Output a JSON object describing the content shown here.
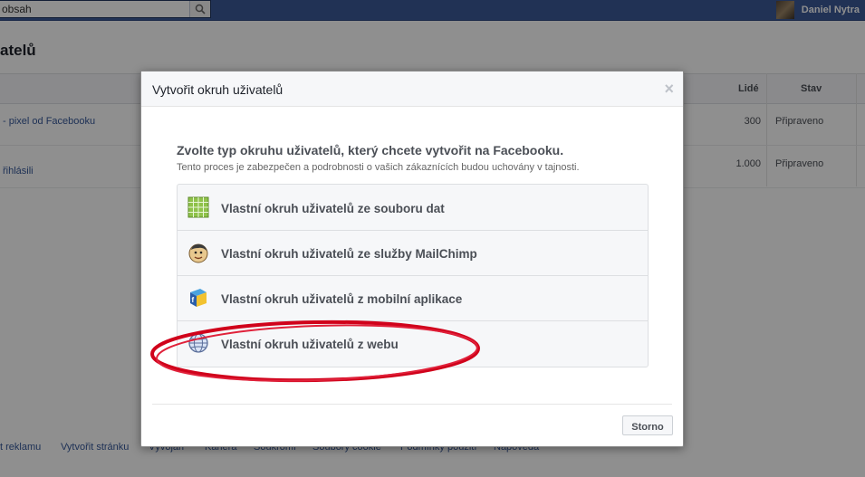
{
  "header": {
    "search_value": "obsah",
    "user_name": "Daniel Nytra"
  },
  "page": {
    "title": "atelů",
    "columns": {
      "lide": "Lidé",
      "stav": "Stav"
    },
    "rows": [
      {
        "name": "- pixel od Facebooku",
        "count": "300",
        "status": "Připraveno"
      },
      {
        "name": "řihlásili",
        "count": "1.000",
        "status": "Připraveno"
      }
    ]
  },
  "footer": {
    "links": [
      "t reklamu",
      "Vytvořit stránku",
      "Vývojáři",
      "Kariéra",
      "Soukromí",
      "Soubory cookie",
      "Podmínky použití",
      "Nápověda"
    ]
  },
  "dialog": {
    "title": "Vytvořit okruh uživatelů",
    "heading": "Zvolte typ okruhu uživatelů, který chcete vytvořit na Facebooku.",
    "subtext": "Tento proces je zabezpečen a podrobnosti o vašich zákaznících budou uchovány v tajnosti.",
    "options": [
      {
        "label": "Vlastní okruh uživatelů ze souboru dat",
        "icon": "spreadsheet-icon"
      },
      {
        "label": "Vlastní okruh uživatelů ze služby MailChimp",
        "icon": "mailchimp-icon"
      },
      {
        "label": "Vlastní okruh uživatelů z mobilní aplikace",
        "icon": "mobile-app-icon"
      },
      {
        "label": "Vlastní okruh uživatelů z webu",
        "icon": "globe-icon"
      }
    ],
    "cancel_label": "Storno"
  },
  "colors": {
    "facebook_blue": "#3b5998",
    "annotation_red": "#d0021b"
  }
}
